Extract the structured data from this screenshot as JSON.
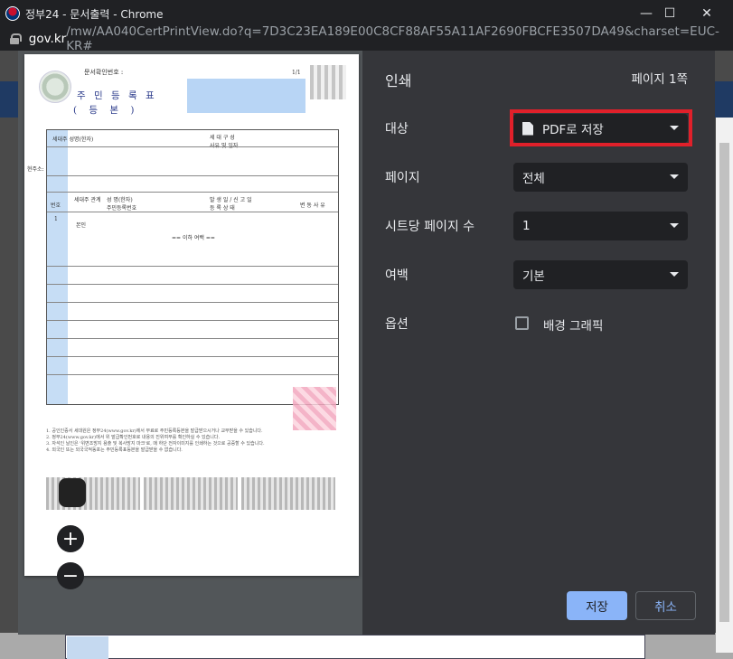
{
  "window": {
    "title": "정부24 - 문서출력 - Chrome",
    "url_host": "gov.kr",
    "url_path": "/mw/AA040CertPrintView.do?q=7D3C23EA189E00C8CF88AF55A11AF2690FBCFE3507DA49&charset=EUC-KR#",
    "minimize_label": "—",
    "maximize_label": "☐",
    "close_label": "✕"
  },
  "print": {
    "header": "인쇄",
    "page_count": "페이지 1쪽",
    "destination_label": "대상",
    "destination_value": "PDF로 저장",
    "pages_label": "페이지",
    "pages_value": "전체",
    "pages_per_sheet_label": "시트당 페이지 수",
    "pages_per_sheet_value": "1",
    "margins_label": "여백",
    "margins_value": "기본",
    "options_label": "옵션",
    "background_graphics_label": "배경 그래픽",
    "save_button": "저장",
    "cancel_button": "취소",
    "zoom_in": "+",
    "zoom_out": "−"
  },
  "document": {
    "doc_number_label": "문서확인번호 :",
    "page_indicator": "1/1",
    "title": "주 민 등 록 표",
    "subtitle": "( 등  본 )",
    "row_header_1": "세대주 성명(한자)",
    "row_header_2": "세 대 구 성\n사유 및 일자",
    "address_label": "현주소:",
    "col_no": "번호",
    "col_relation": "세대주 관계",
    "col_name": "성 명(한자)\n주민등록번호",
    "col_date": "발 생 일 / 신 고 일\n등 록 상 태",
    "col_reason": "변 동 사 유",
    "member_no": "1",
    "member_relation": "본인",
    "blank_marker": "== 이하 여백 ==",
    "notes": [
      "1. 공인인증서 세대원은 정부24(www.gov.kr)에서 무료로 주민등록등본을 발급받으시거나 교부받을 수 있습니다.",
      "2. 정부24(www.gov.kr)에서 위 발급확인번호로 내용의 진위여부를 확인하실 수 있습니다.",
      "3. 자석인 날인은 '위변조방지 용출 및 복사방지 마크'로, 매 하단 전자이미지를 인쇄하는 것으로 공증할 수 있습니다.",
      "4. 외국인 또는 외국국적동포는 주민등록표등본을 발급받을 수 없습니다."
    ]
  }
}
